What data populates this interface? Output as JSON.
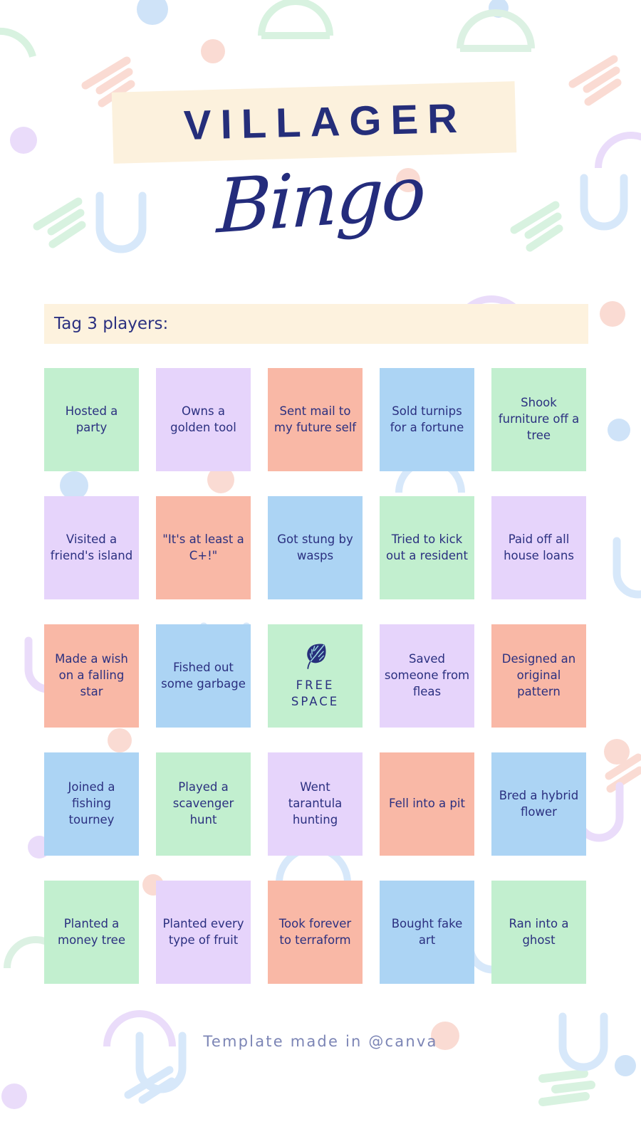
{
  "title": {
    "main": "VILLAGER",
    "script": "Bingo"
  },
  "tag_prompt": {
    "label": "Tag 3 players:"
  },
  "footer": {
    "text": "Template made in @canva"
  },
  "colors": {
    "navy": "#2B3080",
    "cream": "#FDF2DE",
    "green": "#C2EFCF",
    "lavender": "#E6D4FB",
    "peach": "#F9B8A6",
    "blue": "#ACD4F4",
    "footer_text": "#7C85B5",
    "background": "#FFFFFF"
  },
  "bingo": {
    "rows": 5,
    "columns": 5,
    "cells": [
      {
        "text": "Hosted a party",
        "color": "#C2EFCF",
        "color_name": "green"
      },
      {
        "text": "Owns a golden tool",
        "color": "#E6D4FB",
        "color_name": "lavender"
      },
      {
        "text": "Sent mail to my future self",
        "color": "#F9B8A6",
        "color_name": "peach"
      },
      {
        "text": "Sold turnips for a fortune",
        "color": "#ACD4F4",
        "color_name": "blue"
      },
      {
        "text": "Shook furniture off a tree",
        "color": "#C2EFCF",
        "color_name": "green"
      },
      {
        "text": "Visited a friend's island",
        "color": "#E6D4FB",
        "color_name": "lavender"
      },
      {
        "text": "\"It's at least a C+!\"",
        "color": "#F9B8A6",
        "color_name": "peach"
      },
      {
        "text": "Got stung by wasps",
        "color": "#ACD4F4",
        "color_name": "blue"
      },
      {
        "text": "Tried to kick out a resident",
        "color": "#C2EFCF",
        "color_name": "green"
      },
      {
        "text": "Paid off all house loans",
        "color": "#E6D4FB",
        "color_name": "lavender"
      },
      {
        "text": "Made a wish on a falling star",
        "color": "#F9B8A6",
        "color_name": "peach"
      },
      {
        "text": "Fished out some garbage",
        "color": "#ACD4F4",
        "color_name": "blue"
      },
      {
        "text": "FREE SPACE",
        "color": "#C2EFCF",
        "color_name": "green",
        "free": true,
        "icon": "leaf-icon"
      },
      {
        "text": "Saved someone from fleas",
        "color": "#E6D4FB",
        "color_name": "lavender"
      },
      {
        "text": "Designed an original pattern",
        "color": "#F9B8A6",
        "color_name": "peach"
      },
      {
        "text": "Joined a fishing tourney",
        "color": "#ACD4F4",
        "color_name": "blue"
      },
      {
        "text": "Played a scavenger hunt",
        "color": "#C2EFCF",
        "color_name": "green"
      },
      {
        "text": "Went tarantula hunting",
        "color": "#E6D4FB",
        "color_name": "lavender"
      },
      {
        "text": "Fell into a pit",
        "color": "#F9B8A6",
        "color_name": "peach"
      },
      {
        "text": "Bred a hybrid flower",
        "color": "#ACD4F4",
        "color_name": "blue"
      },
      {
        "text": "Planted a money tree",
        "color": "#C2EFCF",
        "color_name": "green"
      },
      {
        "text": "Planted every type of fruit",
        "color": "#E6D4FB",
        "color_name": "lavender"
      },
      {
        "text": "Took forever to terraform",
        "color": "#F9B8A6",
        "color_name": "peach"
      },
      {
        "text": "Bought fake art",
        "color": "#ACD4F4",
        "color_name": "blue"
      },
      {
        "text": "Ran into a ghost",
        "color": "#C2EFCF",
        "color_name": "green"
      }
    ]
  }
}
